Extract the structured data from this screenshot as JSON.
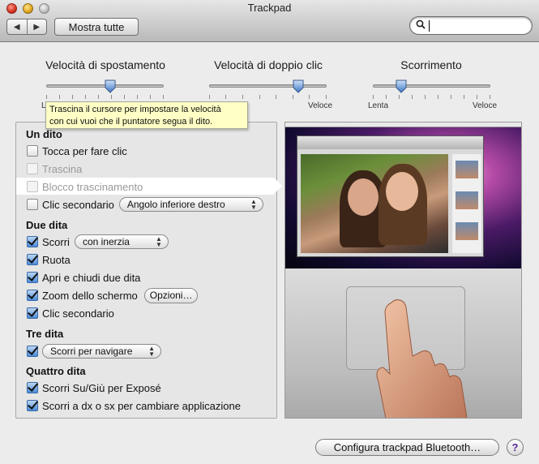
{
  "window": {
    "title": "Trackpad"
  },
  "toolbar": {
    "back_icon": "◀",
    "forward_icon": "▶",
    "show_all_label": "Mostra tutte",
    "search_icon": "🔍",
    "search_value": ""
  },
  "sliders": [
    {
      "label": "Velocità di spostamento",
      "min_label": "Le",
      "max_label": "",
      "value_fraction": 0.55
    },
    {
      "label": "Velocità di doppio clic",
      "min_label": "",
      "max_label": "Veloce",
      "value_fraction": 0.75
    },
    {
      "label": "Scorrimento",
      "min_label": "Lenta",
      "max_label": "Veloce",
      "value_fraction": 0.25
    }
  ],
  "tooltip": {
    "line1": "Trascina il cursore per impostare la velocità",
    "line2": "con cui vuoi che il puntatore segua il dito."
  },
  "sections": {
    "one_finger": {
      "title": "Un dito",
      "tap_to_click": {
        "label": "Tocca per fare clic",
        "checked": false
      },
      "drag": {
        "label": "Trascina",
        "checked": false,
        "enabled": false
      },
      "drag_lock": {
        "label": "Blocco trascinamento",
        "checked": false,
        "enabled": false
      },
      "secondary_click": {
        "label": "Clic secondario",
        "checked": false,
        "popup": "Angolo inferiore destro"
      }
    },
    "two_fingers": {
      "title": "Due dita",
      "scroll": {
        "label": "Scorri",
        "checked": true,
        "popup": "con inerzia"
      },
      "rotate": {
        "label": "Ruota",
        "checked": true
      },
      "pinch": {
        "label": "Apri e chiudi due dita",
        "checked": true
      },
      "screen_zoom": {
        "label": "Zoom dello schermo",
        "checked": true,
        "button": "Opzioni…"
      },
      "secondary_click": {
        "label": "Clic secondario",
        "checked": true
      }
    },
    "three_fingers": {
      "title": "Tre dita",
      "gesture": {
        "checked": true,
        "popup": "Scorri per navigare"
      }
    },
    "four_fingers": {
      "title": "Quattro dita",
      "expose": {
        "label": "Scorri Su/Giù per Exposé",
        "checked": true
      },
      "switch_app": {
        "label": "Scorri a dx o sx per cambiare applicazione",
        "checked": true
      }
    }
  },
  "footer": {
    "bluetooth_button": "Configura trackpad Bluetooth…",
    "help_label": "?"
  }
}
